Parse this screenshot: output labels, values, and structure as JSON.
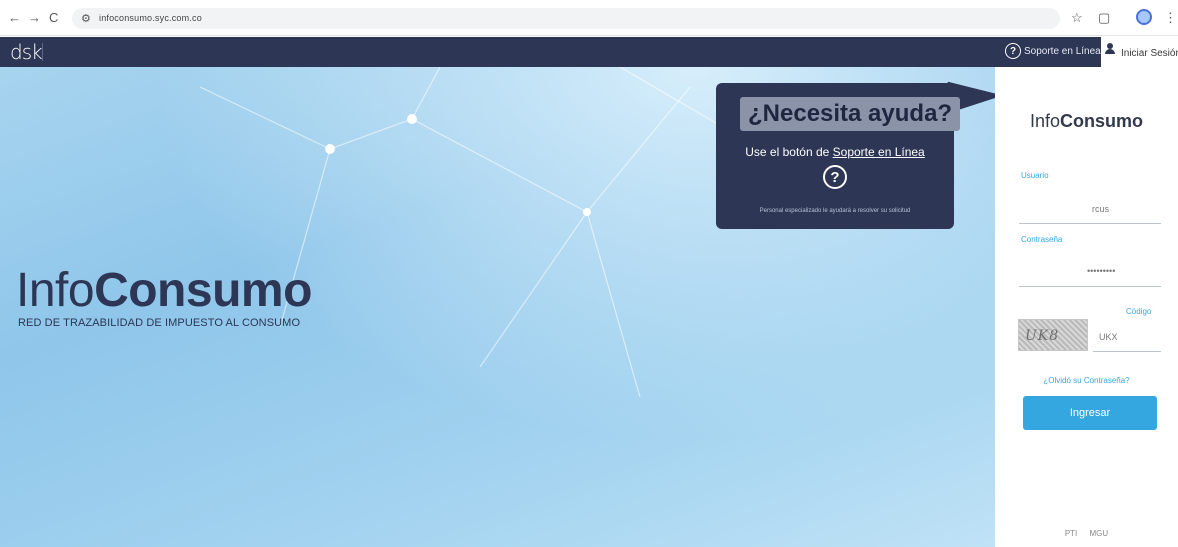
{
  "browser": {
    "back": "←",
    "forward": "→",
    "reload": "C",
    "site_icon": "⚙",
    "url": "infoconsumo.syc.com.co"
  },
  "header": {
    "logo": "dsk",
    "support_label": "Soporte en Línea",
    "login_label": "Iniciar Sesión"
  },
  "hero": {
    "brand_light": "Info",
    "brand_bold": "Consumo",
    "subtitle": "RED DE TRAZABILIDAD DE IMPUESTO AL CONSUMO"
  },
  "help": {
    "title": "¿Necesita ayuda?",
    "text_prefix": "Use el botón de ",
    "text_link": "Soporte en Línea",
    "footer": "Personal especializado le ayudará a resolver su solicitud"
  },
  "login": {
    "title_light": "Info",
    "title_bold": "Consumo",
    "user_label": "Usuario",
    "user_value": "rcus",
    "password_label": "Contraseña",
    "password_value": "•••••••••",
    "code_label": "Código",
    "captcha_text": "UK8",
    "code_value": "UKX",
    "forgot": "¿Olvidó su Contraseña?",
    "submit": "Ingresar",
    "footer": [
      "PTI",
      "MGU"
    ]
  },
  "colors": {
    "header_bg": "#2d3654",
    "accent": "#35a7e0"
  }
}
